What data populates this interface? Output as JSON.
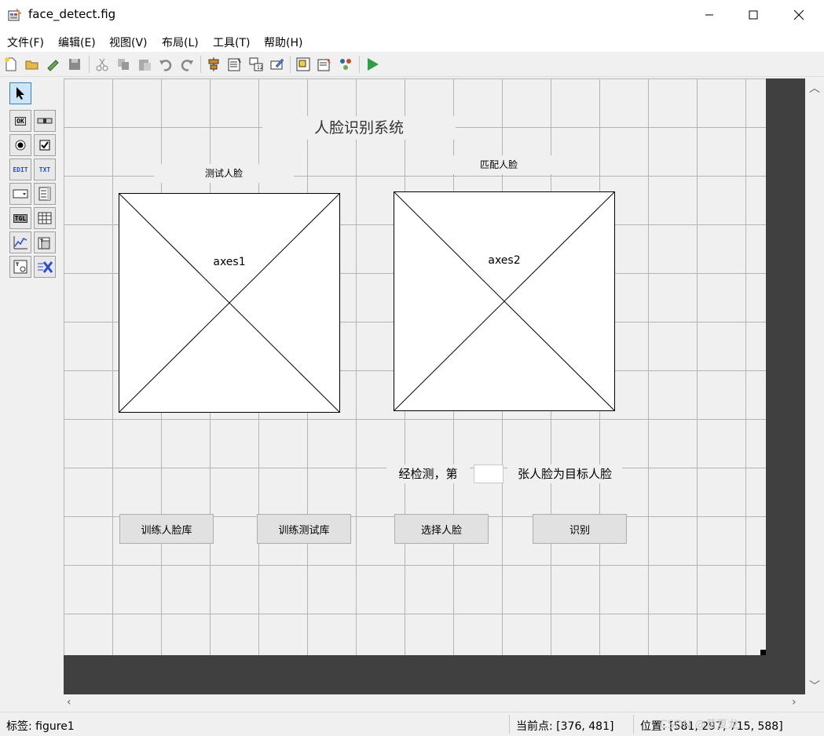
{
  "window": {
    "title": "face_detect.fig"
  },
  "menu": [
    "文件(F)",
    "编辑(E)",
    "视图(V)",
    "布局(L)",
    "工具(T)",
    "帮助(H)"
  ],
  "palette": {
    "push_button": "OK",
    "edit_text": "EDIT",
    "static_text": "TXT",
    "toggle_button": "TGL"
  },
  "figure": {
    "title_text": "人脸识别系统",
    "label_test": "测试人脸",
    "label_match": "匹配人脸",
    "axes1": "axes1",
    "axes2": "axes2",
    "result_prefix": "经检测，第",
    "result_suffix": "张人脸为目标人脸",
    "result_value": "",
    "buttons": [
      "训练人脸库",
      "训练测试库",
      "选择人脸",
      "识别"
    ]
  },
  "status": {
    "tag": "标签: figure1",
    "current_point": "当前点:  [376, 481]",
    "position": "位置: [581, 297, 715, 588]"
  },
  "watermark": "CSDN @黄夏龙"
}
